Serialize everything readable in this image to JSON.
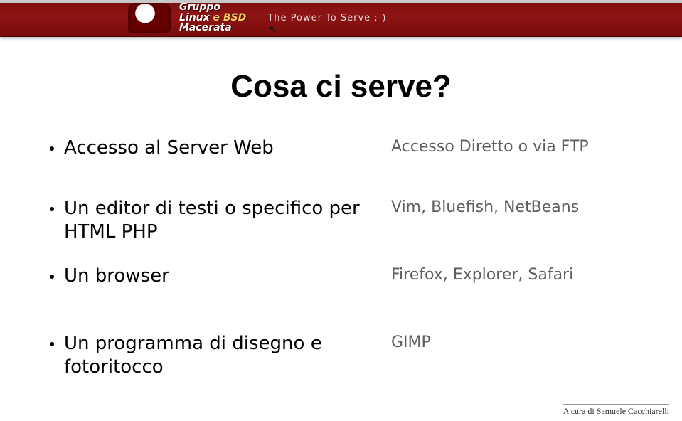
{
  "header": {
    "brand_line1": "Gruppo",
    "brand_line2_linux": "Linux",
    "brand_line2_e": " e ",
    "brand_line2_bsd": "BSD",
    "brand_line3": "Macerata",
    "tagline": "The Power To Serve ;-)"
  },
  "slide": {
    "title": "Cosa ci serve?",
    "rows": [
      {
        "left": "Accesso al Server Web",
        "right": "Accesso Diretto o via FTP"
      },
      {
        "left": "Un editor di testi o specifico per HTML PHP",
        "right": "Vim, Bluefish, NetBeans"
      },
      {
        "left": "Un browser",
        "right": "Firefox, Explorer, Safari"
      },
      {
        "left": "Un programma di disegno e fotoritocco",
        "right": "GIMP"
      }
    ]
  },
  "footer": "A cura di Samuele Cacchiarelli"
}
